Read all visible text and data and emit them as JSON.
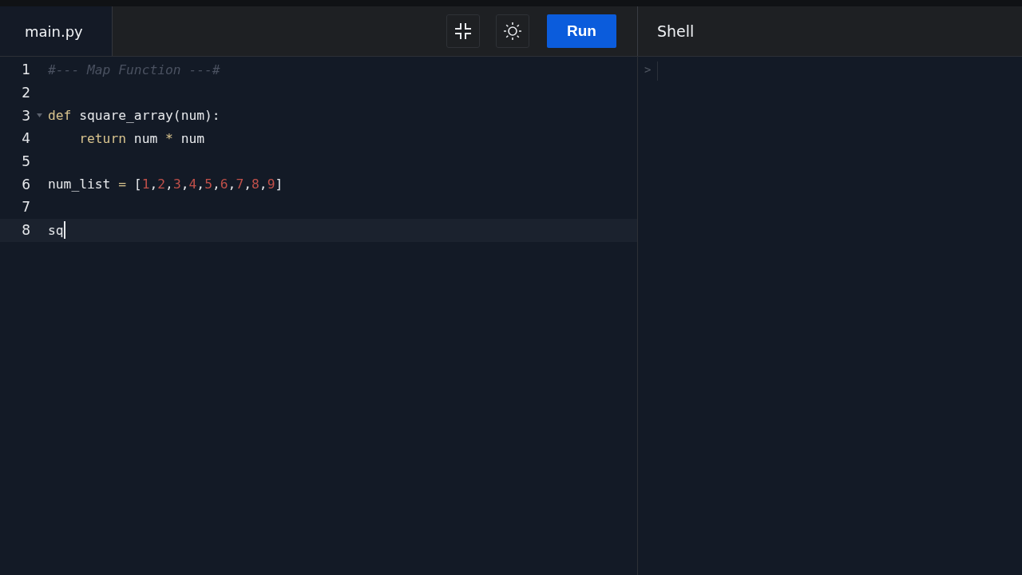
{
  "tab": {
    "label": "main.py",
    "selected": true
  },
  "toolbar": {
    "run_label": "Run"
  },
  "shell": {
    "title": "Shell",
    "prompt": ">"
  },
  "editor": {
    "lines": [
      {
        "number": "1",
        "active": false,
        "fold": false,
        "tokens": [
          {
            "kind": "comment",
            "text": "#--- Map Function ---#"
          }
        ]
      },
      {
        "number": "2",
        "active": false,
        "fold": false
      },
      {
        "number": "3",
        "active": false,
        "fold": true,
        "tokens": [
          {
            "kind": "keyword",
            "text": "def"
          },
          {
            "kind": "plain",
            "text": " square_array(num):"
          }
        ]
      },
      {
        "number": "4",
        "active": false,
        "fold": false,
        "indented": true,
        "tokens": [
          {
            "kind": "keyword",
            "text": "return"
          },
          {
            "kind": "plain",
            "text": " num "
          },
          {
            "kind": "operator",
            "text": "*"
          },
          {
            "kind": "plain",
            "text": " num"
          }
        ]
      },
      {
        "number": "5",
        "active": false,
        "fold": false
      },
      {
        "number": "6",
        "active": false,
        "fold": false,
        "tokens": [
          {
            "kind": "plain",
            "text": "num_list "
          },
          {
            "kind": "operator",
            "text": "="
          },
          {
            "kind": "plain",
            "text": " ["
          },
          {
            "kind": "number",
            "text": "1"
          },
          {
            "kind": "plain",
            "text": ","
          },
          {
            "kind": "number",
            "text": "2"
          },
          {
            "kind": "plain",
            "text": ","
          },
          {
            "kind": "number",
            "text": "3"
          },
          {
            "kind": "plain",
            "text": ","
          },
          {
            "kind": "number",
            "text": "4"
          },
          {
            "kind": "plain",
            "text": ","
          },
          {
            "kind": "number",
            "text": "5"
          },
          {
            "kind": "plain",
            "text": ","
          },
          {
            "kind": "number",
            "text": "6"
          },
          {
            "kind": "plain",
            "text": ","
          },
          {
            "kind": "number",
            "text": "7"
          },
          {
            "kind": "plain",
            "text": ","
          },
          {
            "kind": "number",
            "text": "8"
          },
          {
            "kind": "plain",
            "text": ","
          },
          {
            "kind": "number",
            "text": "9"
          },
          {
            "kind": "plain",
            "text": "]"
          }
        ]
      },
      {
        "number": "7",
        "active": false,
        "fold": false
      },
      {
        "number": "8",
        "active": true,
        "fold": false,
        "tokens": [
          {
            "kind": "plain",
            "text": "sq"
          }
        ]
      }
    ]
  }
}
